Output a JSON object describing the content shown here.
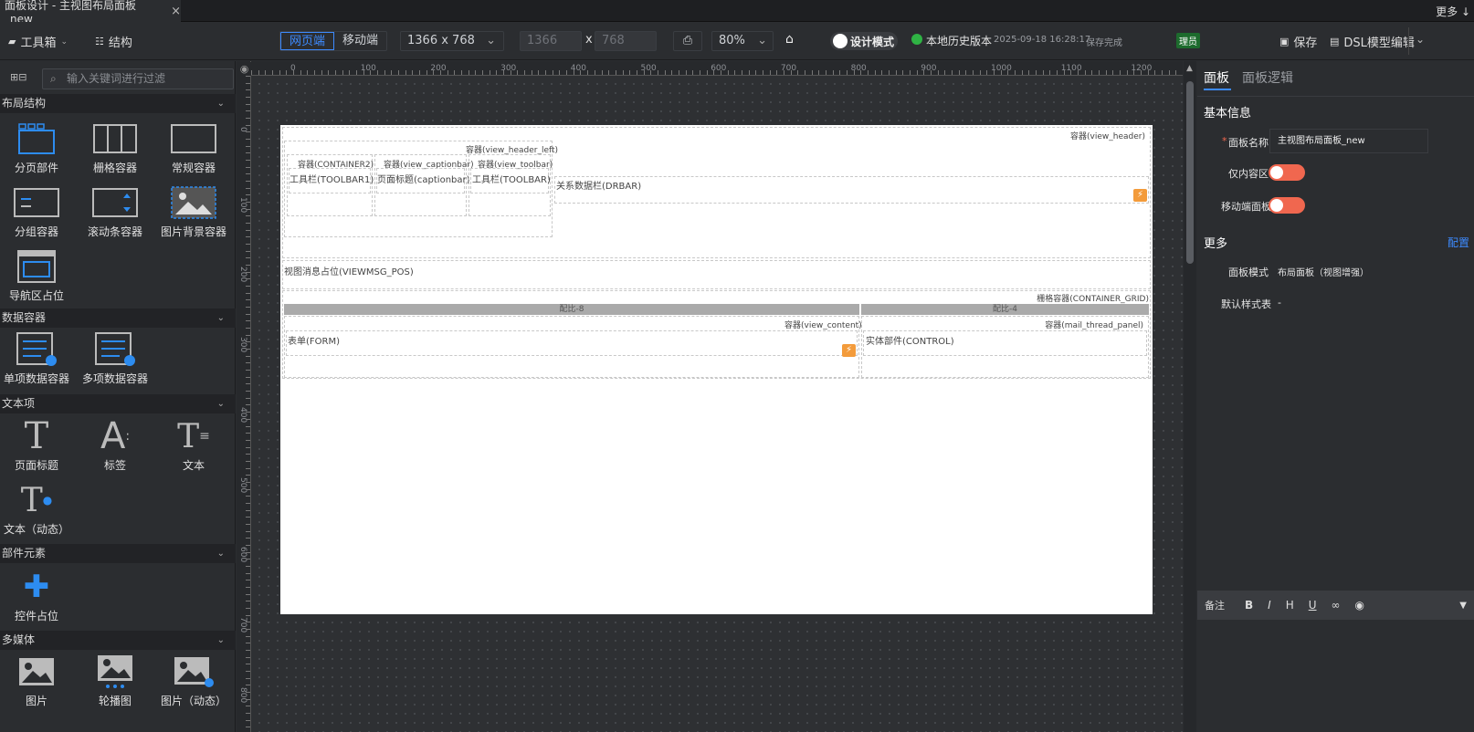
{
  "window": {
    "tab_title": "面板设计 - 主视图布局面板_new",
    "more": "更多"
  },
  "toolbar": {
    "toolbox": "工具箱",
    "structure": "结构",
    "platform_web": "网页端",
    "platform_mobile": "移动端",
    "resolution": "1366 x 768",
    "width_placeholder": "1366",
    "height_placeholder": "768",
    "times": "x",
    "zoom": "80%",
    "design_mode": "设计模式",
    "history_label": "本地历史版本",
    "history_time": "2025-09-18 16:28:17",
    "save_status": "保存完成",
    "user_badge": "理员",
    "save": "保存",
    "dsl_edit": "DSL模型编辑"
  },
  "left": {
    "search_placeholder": "输入关键词进行过滤",
    "sections": [
      {
        "title": "布局结构",
        "items": [
          "分页部件",
          "栅格容器",
          "常规容器",
          "分组容器",
          "滚动条容器",
          "图片背景容器",
          "导航区占位"
        ]
      },
      {
        "title": "数据容器",
        "items": [
          "单项数据容器",
          "多项数据容器"
        ]
      },
      {
        "title": "文本项",
        "items": [
          "页面标题",
          "标签",
          "文本",
          "文本（动态）"
        ]
      },
      {
        "title": "部件元素",
        "items": [
          "控件占位"
        ]
      },
      {
        "title": "多媒体",
        "items": [
          "图片",
          "轮播图",
          "图片（动态）"
        ]
      }
    ]
  },
  "ruler": {
    "h": [
      "0",
      "100",
      "200",
      "300",
      "400",
      "500",
      "600",
      "700",
      "800",
      "900",
      "1000",
      "1100",
      "1200"
    ],
    "v": [
      "0",
      "100",
      "200",
      "300",
      "400",
      "500",
      "600",
      "700",
      "800"
    ]
  },
  "canvas": {
    "view_header": "容器(view_header)",
    "view_header_left": "容器(view_header_left)",
    "container2": "容器(CONTAINER2)",
    "view_captionbar": "容器(view_captionbar)",
    "view_toolbar": "容器(view_toolbar)",
    "toolbar1": "工具栏(TOOLBAR1)",
    "captionbar": "页面标题(captionbar)",
    "toolbar": "工具栏(TOOLBAR)",
    "drbar": "关系数据栏(DRBAR)",
    "viewmsg": "视图消息占位(VIEWMSG_POS)",
    "container_grid": "栅格容器(CONTAINER_GRID)",
    "ratio_left": "配比-8",
    "ratio_right": "配比-4",
    "view_content": "容器(view_content)",
    "mail_thread_panel": "容器(mail_thread_panel)",
    "form": "表单(FORM)",
    "control": "实体部件(CONTROL)"
  },
  "right": {
    "tab_panel": "面板",
    "tab_logic": "面板逻辑",
    "basic_info": "基本信息",
    "required_mark": "*",
    "panel_name_label": "面板名称",
    "panel_name_value": "主视图布局面板_new",
    "inner_only_label": "仅内容区",
    "mobile_label": "移动端面板",
    "more": "更多",
    "config": "配置",
    "panel_mode_label": "面板模式",
    "panel_mode_value": "布局面板（视图增强）",
    "default_style_label": "默认样式表",
    "default_style_value": "-",
    "note_label": "备注",
    "editor_tools": [
      "B",
      "I",
      "H",
      "U"
    ]
  }
}
